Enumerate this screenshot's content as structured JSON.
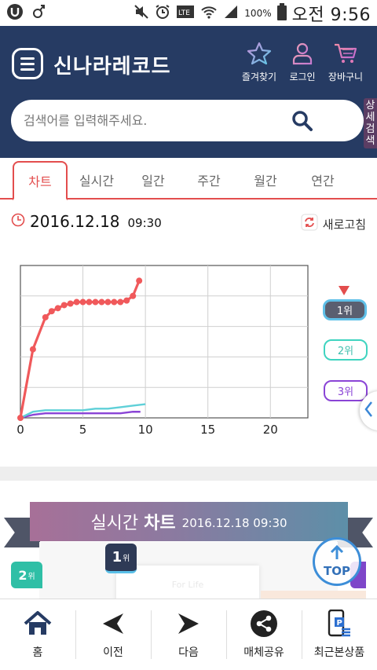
{
  "status_bar": {
    "battery": "100%",
    "time": "오전 9:56",
    "icons": [
      "u-plus-icon",
      "female-icon",
      "mute-icon",
      "alarm-icon",
      "lte-icon",
      "wifi-icon",
      "signal-icon",
      "battery-icon"
    ]
  },
  "header": {
    "brand": "신나라레코드",
    "actions": [
      {
        "label": "즐겨찾기",
        "icon": "star-icon"
      },
      {
        "label": "로그인",
        "icon": "person-icon"
      },
      {
        "label": "장바구니",
        "icon": "cart-icon"
      }
    ],
    "search": {
      "placeholder": "검색어를 입력해주세요."
    },
    "detail_search": "상세검색",
    "colors": {
      "background": "#263b63",
      "accent": "#e34d4d"
    }
  },
  "tabs": [
    {
      "label": "차트",
      "active": true
    },
    {
      "label": "실시간",
      "active": false
    },
    {
      "label": "일간",
      "active": false
    },
    {
      "label": "주간",
      "active": false
    },
    {
      "label": "월간",
      "active": false
    },
    {
      "label": "연간",
      "active": false
    }
  ],
  "chart_header": {
    "date": "2016.12.18",
    "time": "09:30",
    "refresh_label": "새로고침"
  },
  "chart_data": {
    "type": "line",
    "xlim": [
      0,
      23
    ],
    "ylim": [
      0,
      100
    ],
    "x_ticks": [
      "0",
      "5",
      "10",
      "15",
      "20"
    ],
    "grid": true,
    "legend": "right",
    "series": [
      {
        "name": "1위",
        "color": "#f0595b",
        "x": [
          0,
          1,
          2,
          2.5,
          3,
          3.5,
          4,
          4.5,
          5,
          5.5,
          6,
          6.5,
          7,
          7.5,
          8,
          8.5,
          9,
          9.5
        ],
        "y": [
          0,
          45,
          66,
          70,
          72,
          74,
          75,
          76,
          76,
          76,
          76,
          76,
          76,
          76,
          76,
          77,
          80,
          90
        ]
      },
      {
        "name": "2위",
        "color": "#5fd0d8",
        "x": [
          0,
          1,
          2,
          3,
          4,
          5,
          6,
          7,
          8,
          9,
          10
        ],
        "y": [
          0,
          4,
          5,
          5,
          5,
          5,
          6,
          6,
          7,
          8,
          9
        ]
      },
      {
        "name": "3위",
        "color": "#8a44d6",
        "x": [
          0,
          1,
          2,
          3,
          4,
          5,
          6,
          7,
          8,
          9,
          9.6
        ],
        "y": [
          0,
          2,
          3,
          3,
          3,
          3,
          3,
          3,
          3,
          4,
          4
        ]
      }
    ]
  },
  "realtime": {
    "title_prefix": "실시간",
    "title_bold": "차트",
    "datetime": "2016.12.18 09:30",
    "card_text": "For Life",
    "badge_1": "1",
    "badge_2": "2",
    "rank_suffix": "위",
    "top_label": "TOP"
  },
  "bottom_nav": [
    {
      "label": "홈",
      "icon": "home-icon"
    },
    {
      "label": "이전",
      "icon": "back-arrow-icon"
    },
    {
      "label": "다음",
      "icon": "forward-arrow-icon"
    },
    {
      "label": "매체공유",
      "icon": "share-icon"
    },
    {
      "label": "최근본상품",
      "icon": "recent-products-icon"
    }
  ]
}
